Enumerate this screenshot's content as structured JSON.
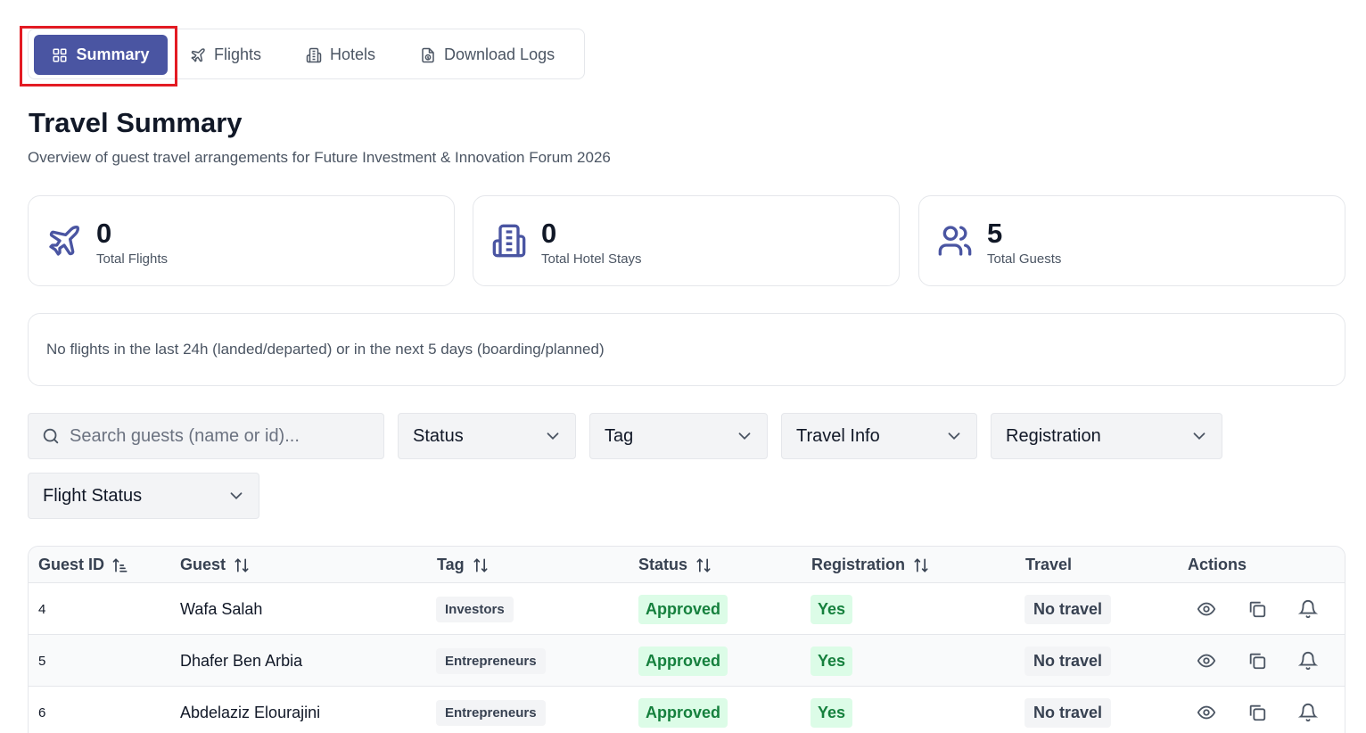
{
  "tabs": [
    {
      "label": "Summary",
      "icon": "grid-icon",
      "active": true
    },
    {
      "label": "Flights",
      "icon": "plane-icon"
    },
    {
      "label": "Hotels",
      "icon": "hotel-icon"
    },
    {
      "label": "Download Logs",
      "icon": "file-download-icon"
    }
  ],
  "highlight_color": "#e31b23",
  "accent_color": "#4a55a2",
  "page": {
    "title": "Travel Summary",
    "subtitle": "Overview of guest travel arrangements for Future Investment & Innovation Forum 2026"
  },
  "stats": [
    {
      "value": "0",
      "label": "Total Flights",
      "icon": "plane-icon"
    },
    {
      "value": "0",
      "label": "Total Hotel Stays",
      "icon": "hotel-icon"
    },
    {
      "value": "5",
      "label": "Total Guests",
      "icon": "users-icon"
    }
  ],
  "notice": "No flights in the last 24h (landed/departed) or in the next 5 days (boarding/planned)",
  "filters": {
    "search_placeholder": "Search guests (name or id)...",
    "selects": [
      "Status",
      "Tag",
      "Travel Info",
      "Registration",
      "Flight Status"
    ]
  },
  "table": {
    "headers": [
      "Guest ID",
      "Guest",
      "Tag",
      "Status",
      "Registration",
      "Travel",
      "Actions"
    ],
    "rows": [
      {
        "id": "4",
        "guest": "Wafa Salah",
        "tag": "Investors",
        "status": "Approved",
        "registration": "Yes",
        "travel": "No travel"
      },
      {
        "id": "5",
        "guest": "Dhafer Ben Arbia",
        "tag": "Entrepreneurs",
        "status": "Approved",
        "registration": "Yes",
        "travel": "No travel"
      },
      {
        "id": "6",
        "guest": "Abdelaziz Elourajini",
        "tag": "Entrepreneurs",
        "status": "Approved",
        "registration": "Yes",
        "travel": "No travel"
      }
    ]
  }
}
